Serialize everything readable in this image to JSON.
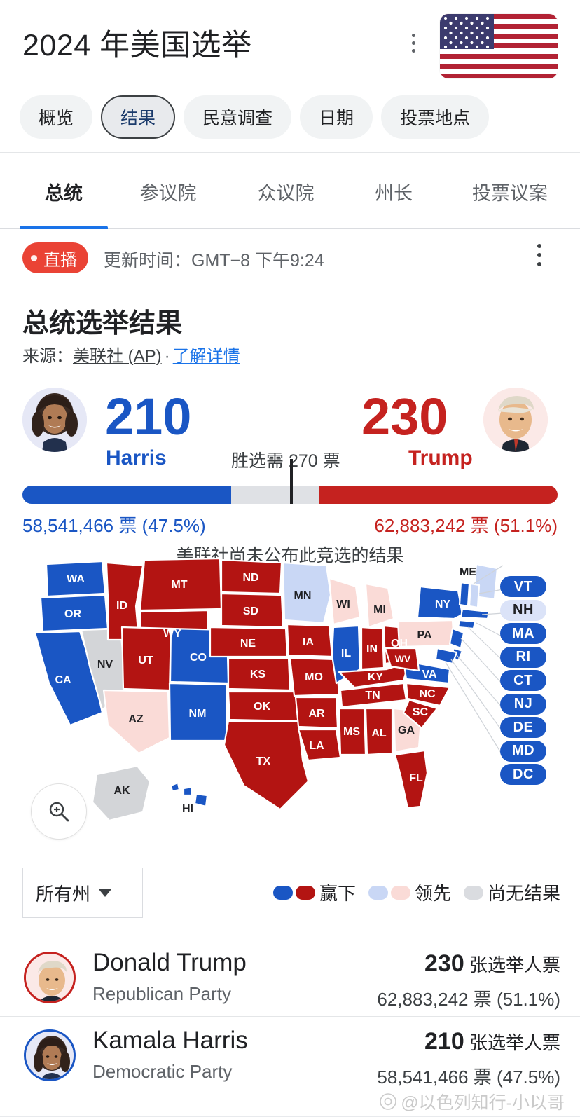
{
  "header": {
    "title": "2024 年美国选举",
    "menu_icon": "kebab-menu-icon",
    "flag_icon": "us-flag-icon",
    "pills": [
      {
        "label": "概览",
        "selected": false
      },
      {
        "label": "结果",
        "selected": true
      },
      {
        "label": "民意调查",
        "selected": false
      },
      {
        "label": "日期",
        "selected": false
      },
      {
        "label": "投票地点",
        "selected": false
      }
    ]
  },
  "tabs": [
    {
      "label": "总统",
      "active": true
    },
    {
      "label": "参议院",
      "active": false
    },
    {
      "label": "众议院",
      "active": false
    },
    {
      "label": "州长",
      "active": false
    },
    {
      "label": "投票议案",
      "active": false
    }
  ],
  "live": {
    "badge": "直播",
    "updated": "更新时间：GMT−8 下午9:24",
    "menu_icon": "kebab-menu-icon"
  },
  "results": {
    "heading": "总统选举结果",
    "source_prefix": "来源：",
    "source_name": "美联社 (AP)",
    "separator": "·",
    "learn_more": "了解详情",
    "not_called": "美联社尚未公布此竞选的结果",
    "threshold_label": "胜选需 270 票"
  },
  "scoreboard": {
    "harris": {
      "name": "Harris",
      "electoral": "210",
      "votes": "58,541,466 票 (47.5%)",
      "color": "#1a56c4",
      "bar_pct": 39.0
    },
    "trump": {
      "name": "Trump",
      "electoral": "230",
      "votes": "62,883,242 票 (51.1%)",
      "color": "#c5221f",
      "bar_pct": 44.5
    }
  },
  "map": {
    "zoom_icon": "zoom-in-icon",
    "colors": {
      "win_d": "#1a56c4",
      "win_r": "#b31412",
      "lean_d": "#c9d7f5",
      "lean_r": "#fadbd7",
      "no_result": "#d3d5d8"
    },
    "states": [
      {
        "code": "WA",
        "status": "win_d"
      },
      {
        "code": "OR",
        "status": "win_d"
      },
      {
        "code": "CA",
        "status": "win_d"
      },
      {
        "code": "NV",
        "status": "no_result"
      },
      {
        "code": "ID",
        "status": "win_r"
      },
      {
        "code": "MT",
        "status": "win_r"
      },
      {
        "code": "WY",
        "status": "win_r"
      },
      {
        "code": "UT",
        "status": "win_r"
      },
      {
        "code": "CO",
        "status": "win_d"
      },
      {
        "code": "AZ",
        "status": "lean_r"
      },
      {
        "code": "NM",
        "status": "win_d"
      },
      {
        "code": "ND",
        "status": "win_r"
      },
      {
        "code": "SD",
        "status": "win_r"
      },
      {
        "code": "NE",
        "status": "win_r"
      },
      {
        "code": "KS",
        "status": "win_r"
      },
      {
        "code": "OK",
        "status": "win_r"
      },
      {
        "code": "TX",
        "status": "win_r"
      },
      {
        "code": "MN",
        "status": "lean_d"
      },
      {
        "code": "IA",
        "status": "win_r"
      },
      {
        "code": "MO",
        "status": "win_r"
      },
      {
        "code": "AR",
        "status": "win_r"
      },
      {
        "code": "LA",
        "status": "win_r"
      },
      {
        "code": "WI",
        "status": "lean_r"
      },
      {
        "code": "IL",
        "status": "win_d"
      },
      {
        "code": "MI",
        "status": "lean_r"
      },
      {
        "code": "IN",
        "status": "win_r"
      },
      {
        "code": "OH",
        "status": "win_r"
      },
      {
        "code": "KY",
        "status": "win_r"
      },
      {
        "code": "TN",
        "status": "win_r"
      },
      {
        "code": "MS",
        "status": "win_r"
      },
      {
        "code": "AL",
        "status": "win_r"
      },
      {
        "code": "GA",
        "status": "lean_r"
      },
      {
        "code": "FL",
        "status": "win_r"
      },
      {
        "code": "SC",
        "status": "win_r"
      },
      {
        "code": "NC",
        "status": "win_r"
      },
      {
        "code": "VA",
        "status": "win_d"
      },
      {
        "code": "WV",
        "status": "win_r"
      },
      {
        "code": "PA",
        "status": "lean_r"
      },
      {
        "code": "NY",
        "status": "win_d"
      },
      {
        "code": "ME",
        "status": "lean_d"
      },
      {
        "code": "AK",
        "status": "no_result"
      },
      {
        "code": "HI",
        "status": "win_d"
      }
    ],
    "callouts": [
      {
        "code": "VT",
        "status": "win_d"
      },
      {
        "code": "NH",
        "status": "lean_d"
      },
      {
        "code": "MA",
        "status": "win_d"
      },
      {
        "code": "RI",
        "status": "win_d"
      },
      {
        "code": "CT",
        "status": "win_d"
      },
      {
        "code": "NJ",
        "status": "win_d"
      },
      {
        "code": "DE",
        "status": "win_d"
      },
      {
        "code": "MD",
        "status": "win_d"
      },
      {
        "code": "DC",
        "status": "win_d"
      }
    ]
  },
  "filter": {
    "label": "所有州",
    "caret_icon": "chevron-down-icon"
  },
  "legend": [
    {
      "label": "赢下",
      "swatches": [
        "win_d",
        "win_r"
      ]
    },
    {
      "label": "领先",
      "swatches": [
        "lean_d",
        "lean_r"
      ]
    },
    {
      "label": "尚无结果",
      "swatches": [
        "no_result"
      ]
    }
  ],
  "candidates": [
    {
      "name": "Donald Trump",
      "party": "Republican Party",
      "electoral_value": "230",
      "electoral_unit": "张选举人票",
      "popular": "62,883,242 票 (51.1%)",
      "party_class": "r"
    },
    {
      "name": "Kamala Harris",
      "party": "Democratic Party",
      "electoral_value": "210",
      "electoral_unit": "张选举人票",
      "popular": "58,541,466 票 (47.5%)",
      "party_class": "d"
    }
  ],
  "watermark": {
    "text": "@以色列知行-小以哥",
    "icon": "weibo-eye-icon"
  }
}
